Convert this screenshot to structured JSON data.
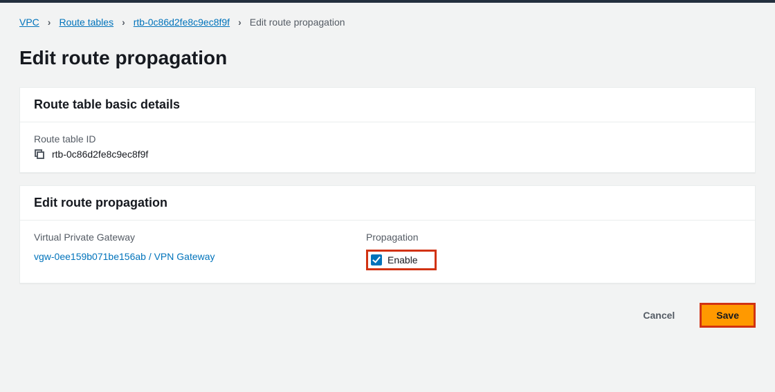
{
  "breadcrumb": {
    "root": "VPC",
    "tables": "Route tables",
    "rtId": "rtb-0c86d2fe8c9ec8f9f",
    "current": "Edit route propagation"
  },
  "pageTitle": "Edit route propagation",
  "detailsPanel": {
    "title": "Route table basic details",
    "idLabel": "Route table ID",
    "idValue": "rtb-0c86d2fe8c9ec8f9f"
  },
  "propagationPanel": {
    "title": "Edit route propagation",
    "vgwHeader": "Virtual Private Gateway",
    "propHeader": "Propagation",
    "vgwValue": "vgw-0ee159b071be156ab / VPN Gateway",
    "enableLabel": "Enable"
  },
  "actions": {
    "cancel": "Cancel",
    "save": "Save"
  }
}
